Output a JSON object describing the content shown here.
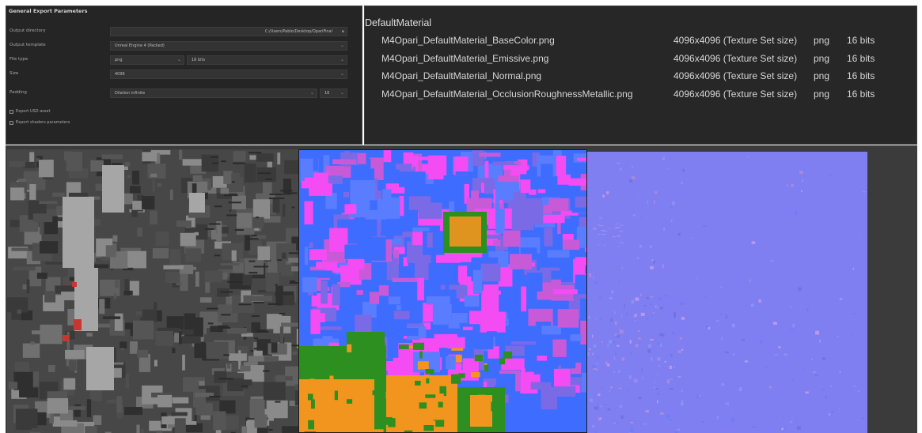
{
  "export_params": {
    "title": "General Export Parameters",
    "rows": {
      "output_directory": {
        "label": "Output directory",
        "value": "C:/Users/Pablo/Desktop/OpariFinal"
      },
      "output_template": {
        "label": "Output template",
        "value": "Unreal Engine 4 (Packed)"
      },
      "file_type": {
        "label": "File type",
        "value": "png",
        "secondary_value": "16 bits"
      },
      "size": {
        "label": "Size",
        "value": "4096"
      },
      "padding": {
        "label": "Padding",
        "value": "Dilation infinite",
        "secondary_value": "16"
      }
    },
    "checkboxes": {
      "export_usd": {
        "label": "Export USD asset",
        "checked": false
      },
      "export_shader_params": {
        "label": "Export shaders parameters",
        "checked": false
      }
    }
  },
  "files_panel": {
    "set_name": "DefaultMaterial",
    "files": [
      {
        "name": "M4Opari_DefaultMaterial_BaseColor.png",
        "size": "4096x4096 (Texture Set size)",
        "format": "png",
        "bits": "16 bits"
      },
      {
        "name": "M4Opari_DefaultMaterial_Emissive.png",
        "size": "4096x4096 (Texture Set size)",
        "format": "png",
        "bits": "16 bits"
      },
      {
        "name": "M4Opari_DefaultMaterial_Normal.png",
        "size": "4096x4096 (Texture Set size)",
        "format": "png",
        "bits": "16 bits"
      },
      {
        "name": "M4Opari_DefaultMaterial_OcclusionRoughnessMetallic.png",
        "size": "4096x4096 (Texture Set size)",
        "format": "png",
        "bits": "16 bits"
      }
    ]
  },
  "textures": {
    "base_color": {
      "colors": {
        "background": "#474747",
        "mid": "#6a6a6a",
        "light": "#a6a6a6",
        "accent": "#c8372d"
      }
    },
    "emissive": {
      "colors": {
        "blue": "#3d6cff",
        "magenta": "#f24cf2",
        "green": "#2d8f1f",
        "orange": "#f2951e"
      }
    },
    "normal": {
      "colors": {
        "background": "#7f7ff2"
      }
    }
  },
  "icons": {
    "dropdown": "chevron-down-icon",
    "folder": "folder-icon"
  }
}
